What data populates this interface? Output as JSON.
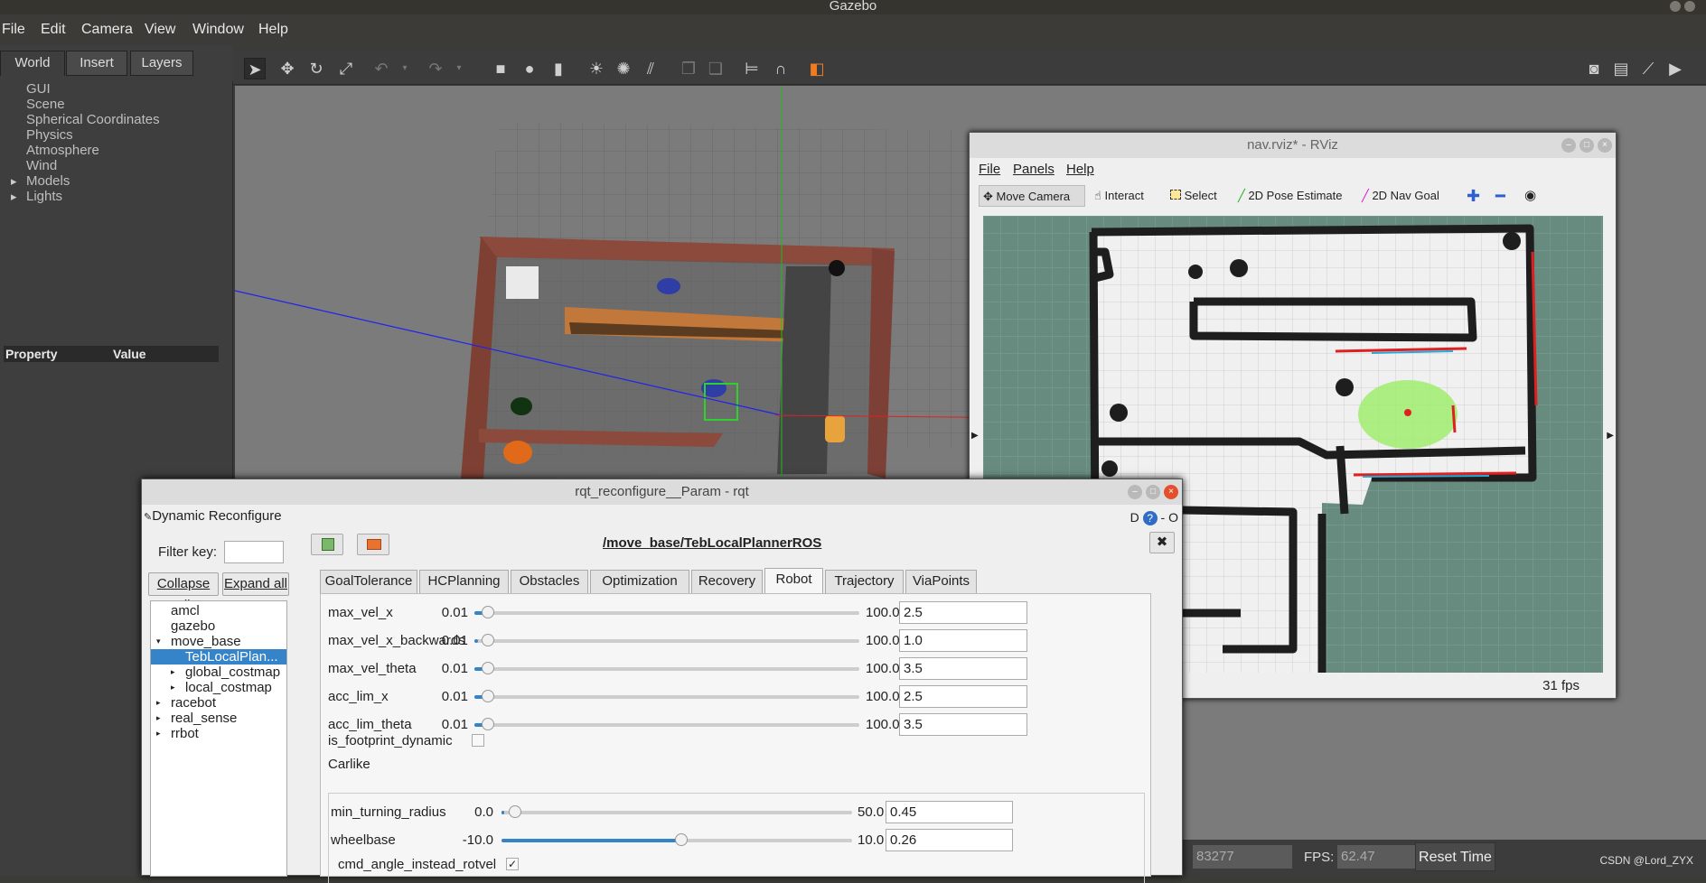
{
  "gazebo": {
    "title": "Gazebo",
    "menu": [
      "File",
      "Edit",
      "Camera",
      "View",
      "Window",
      "Help"
    ],
    "tabs": [
      "World",
      "Insert",
      "Layers"
    ],
    "tree": [
      {
        "label": "GUI",
        "arrow": ""
      },
      {
        "label": "Scene",
        "arrow": ""
      },
      {
        "label": "Spherical Coordinates",
        "arrow": ""
      },
      {
        "label": "Physics",
        "arrow": ""
      },
      {
        "label": "Atmosphere",
        "arrow": ""
      },
      {
        "label": "Wind",
        "arrow": ""
      },
      {
        "label": "Models",
        "arrow": "▸"
      },
      {
        "label": "Lights",
        "arrow": "▸"
      }
    ],
    "property_header": "Property",
    "value_header": "Value",
    "iterations_value": "83277",
    "fps_label": "FPS:",
    "fps_value": "62.47",
    "reset_time": "Reset Time"
  },
  "rviz": {
    "title": "nav.rviz* - RViz",
    "menu": [
      "File",
      "Panels",
      "Help"
    ],
    "tools": [
      {
        "label": "Move Camera",
        "icon": "move-camera-icon"
      },
      {
        "label": "Interact",
        "icon": "hand-icon"
      },
      {
        "label": "Select",
        "icon": "select-icon"
      },
      {
        "label": "2D Pose Estimate",
        "icon": "green-arrow-icon"
      },
      {
        "label": "2D Nav Goal",
        "icon": "magenta-arrow-icon"
      }
    ],
    "fps": "31 fps"
  },
  "rqt": {
    "title": "rqt_reconfigure__Param - rqt",
    "plugin": "Dynamic Reconfigure",
    "dc": "D",
    "filter_label": "Filter key:",
    "collapse_all": "Collapse all",
    "expand_all": "Expand all",
    "tree": [
      {
        "label": "amcl",
        "depth": 0,
        "arrow": "",
        "selected": false
      },
      {
        "label": "gazebo",
        "depth": 0,
        "arrow": "",
        "selected": false
      },
      {
        "label": "move_base",
        "depth": 0,
        "arrow": "▾",
        "selected": false
      },
      {
        "label": "TebLocalPlan...",
        "depth": 1,
        "arrow": "",
        "selected": true
      },
      {
        "label": "global_costmap",
        "depth": 1,
        "arrow": "▸",
        "selected": false
      },
      {
        "label": "local_costmap",
        "depth": 1,
        "arrow": "▸",
        "selected": false
      },
      {
        "label": "racebot",
        "depth": 0,
        "arrow": "▸",
        "selected": false
      },
      {
        "label": "real_sense",
        "depth": 0,
        "arrow": "▸",
        "selected": false
      },
      {
        "label": "rrbot",
        "depth": 0,
        "arrow": "▸",
        "selected": false
      }
    ],
    "param_title": "/move_base/TebLocalPlannerROS",
    "tabs": [
      "GoalTolerance",
      "HCPlanning",
      "Obstacles",
      "Optimization",
      "Recovery",
      "Robot",
      "Trajectory",
      "ViaPoints"
    ],
    "active_tab": "Robot",
    "params": [
      {
        "name": "max_vel_x",
        "min": "0.01",
        "max": "100.0",
        "value": "2.5",
        "frac": 0.025
      },
      {
        "name": "max_vel_x_backwards",
        "min": "0.01",
        "max": "100.0",
        "value": "1.0",
        "frac": 0.01
      },
      {
        "name": "max_vel_theta",
        "min": "0.01",
        "max": "100.0",
        "value": "3.5",
        "frac": 0.035
      },
      {
        "name": "acc_lim_x",
        "min": "0.01",
        "max": "100.0",
        "value": "2.5",
        "frac": 0.025
      },
      {
        "name": "acc_lim_theta",
        "min": "0.01",
        "max": "100.0",
        "value": "3.5",
        "frac": 0.035
      }
    ],
    "is_footprint_dynamic": "is_footprint_dynamic",
    "carlike_label": "Carlike",
    "carlike_params": [
      {
        "name": "min_turning_radius",
        "min": "0.0",
        "max": "50.0",
        "value": "0.45",
        "frac": 0.009
      },
      {
        "name": "wheelbase",
        "min": "-10.0",
        "max": "10.0",
        "value": "0.26",
        "frac": 0.513
      }
    ],
    "cmd_angle_label": "cmd_angle_instead_rotvel",
    "cmd_angle_checked": "✓"
  },
  "watermark": "CSDN @Lord_ZYX",
  "colors": {
    "accent": "#3584c9",
    "selected": "#3584c9",
    "wall": "#8b4a3c",
    "map_bg": "#688b80"
  }
}
